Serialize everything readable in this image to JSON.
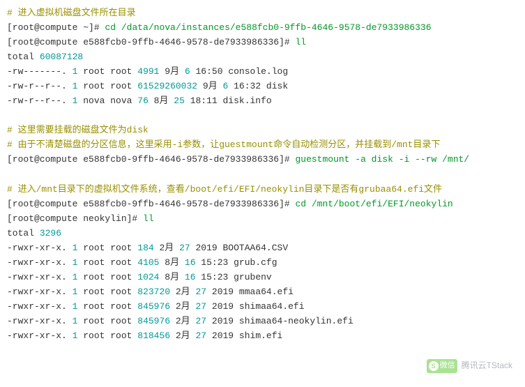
{
  "comments": {
    "c1": "# 进入虚拟机磁盘文件所在目录",
    "c2": "# 这里需要挂载的磁盘文件为disk",
    "c3": "# 由于不清楚磁盘的分区信息，这里采用-i参数，让guestmount命令自动检测分区，并挂载到/mnt目录下",
    "c4": "# 进入/mnt目录下的虚拟机文件系统，查看/boot/efi/EFI/neokylin目录下是否有grubaa64.efi文件"
  },
  "prompts": {
    "p_home": "[root@compute ~]# ",
    "p_inst": "[root@compute e588fcb0-9ffb-4646-9578-de7933986336]# ",
    "p_neo": "[root@compute neokylin]# "
  },
  "cmds": {
    "cd_inst": "cd /data/nova/instances/e588fcb0-9ffb-4646-9578-de7933986336",
    "ll": "ll",
    "guestmount": "guestmount -a disk -i --rw /mnt/",
    "cd_neo": "cd /mnt/boot/efi/EFI/neokylin"
  },
  "totals": {
    "t1_label": "total ",
    "t1_val": "60087128",
    "t2_label": "total ",
    "t2_val": "3296"
  },
  "ls1": [
    {
      "perm": "-rw-------. ",
      "n": "1",
      "own": " root root        ",
      "size": "4991",
      "mon": " 9月   ",
      "day": "6",
      "time": " 16:50",
      "name": " console.log"
    },
    {
      "perm": "-rw-r--r--. ",
      "n": "1",
      "own": " root root ",
      "size": "61529260032",
      "mon": " 9月   ",
      "day": "6",
      "time": " 16:32",
      "name": " disk"
    },
    {
      "perm": "-rw-r--r--. ",
      "n": "1",
      "own": " nova nova          ",
      "size": "76",
      "mon": " 8月  ",
      "day": "25",
      "time": " 18:11",
      "name": " disk.info"
    }
  ],
  "ls2": [
    {
      "perm": "-rwxr-xr-x. ",
      "n": "1",
      "own": " root root    ",
      "size": "184",
      "mon": " 2月  ",
      "day": "27",
      "time": " 2019",
      "name": " BOOTAA64.CSV"
    },
    {
      "perm": "-rwxr-xr-x. ",
      "n": "1",
      "own": " root root   ",
      "size": "4105",
      "mon": " 8月  ",
      "day": "16",
      "time": " 15:23",
      "name": " grub.cfg"
    },
    {
      "perm": "-rwxr-xr-x. ",
      "n": "1",
      "own": " root root   ",
      "size": "1024",
      "mon": " 8月  ",
      "day": "16",
      "time": " 15:23",
      "name": " grubenv"
    },
    {
      "perm": "-rwxr-xr-x. ",
      "n": "1",
      "own": " root root ",
      "size": "823720",
      "mon": " 2月  ",
      "day": "27",
      "time": " 2019",
      "name": " mmaa64.efi"
    },
    {
      "perm": "-rwxr-xr-x. ",
      "n": "1",
      "own": " root root ",
      "size": "845976",
      "mon": " 2月  ",
      "day": "27",
      "time": " 2019",
      "name": " shimaa64.efi"
    },
    {
      "perm": "-rwxr-xr-x. ",
      "n": "1",
      "own": " root root ",
      "size": "845976",
      "mon": " 2月  ",
      "day": "27",
      "time": " 2019",
      "name": " shimaa64-neokylin.efi"
    },
    {
      "perm": "-rwxr-xr-x. ",
      "n": "1",
      "own": " root root ",
      "size": "818456",
      "mon": " 2月  ",
      "day": "27",
      "time": " 2019",
      "name": " shim.efi"
    }
  ],
  "watermark": {
    "badge_char": "S",
    "badge_text": "微信",
    "text": "腾讯云TStack"
  }
}
